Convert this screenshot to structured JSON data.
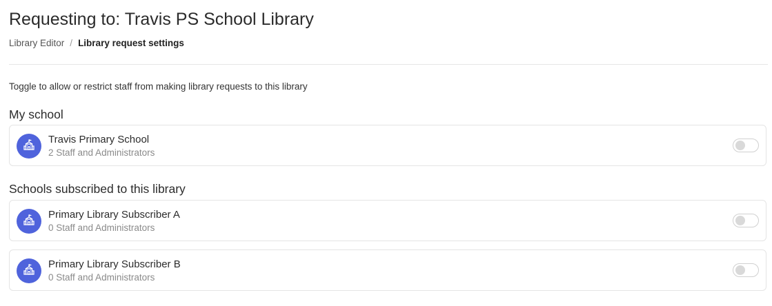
{
  "page": {
    "title": "Requesting to: Travis PS School Library",
    "intro": "Toggle to allow or restrict staff from making library requests to this library"
  },
  "breadcrumb": {
    "parent": "Library Editor",
    "separator": "/",
    "current": "Library request settings"
  },
  "my_school": {
    "heading": "My school",
    "schools": [
      {
        "name": "Travis Primary School",
        "subtitle": "2 Staff and Administrators",
        "enabled": false,
        "icon": "school-icon"
      }
    ]
  },
  "subscribed": {
    "heading": "Schools subscribed to this library",
    "schools": [
      {
        "name": "Primary Library Subscriber A",
        "subtitle": "0 Staff and Administrators",
        "enabled": false,
        "icon": "school-icon"
      },
      {
        "name": "Primary Library Subscriber B",
        "subtitle": "0 Staff and Administrators",
        "enabled": false,
        "icon": "school-icon"
      }
    ]
  },
  "colors": {
    "avatar": "#4f63dc",
    "toggle_off_knob": "#d9d9d9"
  }
}
